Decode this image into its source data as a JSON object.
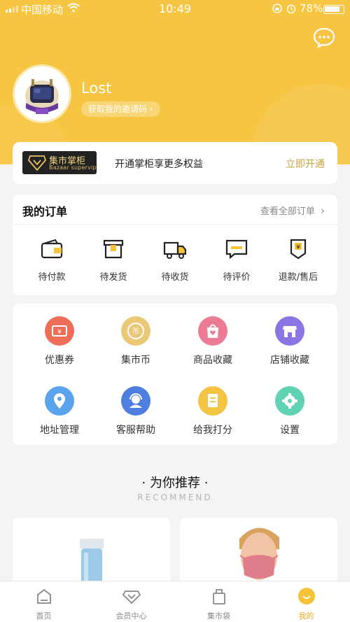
{
  "status_bar": {
    "carrier": "中国移动",
    "time": "10:49",
    "battery": "78%"
  },
  "header": {
    "username": "Lost",
    "invite_label": "获取我的邀请码",
    "invite_chevron": "›",
    "message_icon": "chat-bubble-icon"
  },
  "vip": {
    "badge_title": "集市掌柜",
    "badge_sub": "Bazaar supervip",
    "text": "开通掌柜享更多权益",
    "action": "立即开通"
  },
  "orders": {
    "title": "我的订单",
    "view_all": "查看全部订单",
    "chevron": "›",
    "items": [
      {
        "label": "待付款",
        "icon": "wallet-icon"
      },
      {
        "label": "待发货",
        "icon": "box-icon"
      },
      {
        "label": "待收货",
        "icon": "truck-icon"
      },
      {
        "label": "待评价",
        "icon": "comment-icon"
      },
      {
        "label": "退款/售后",
        "icon": "refund-icon"
      }
    ]
  },
  "tools": {
    "items": [
      {
        "label": "优惠券",
        "icon": "coupon-icon",
        "color": "#ee6e5a",
        "glyph": "¥"
      },
      {
        "label": "集市币",
        "icon": "coin-icon",
        "color": "#e9c876",
        "glyph": "币"
      },
      {
        "label": "商品收藏",
        "icon": "favorite-goods-icon",
        "color": "#ec7c95",
        "glyph": ""
      },
      {
        "label": "店铺收藏",
        "icon": "favorite-shop-icon",
        "color": "#8b74e4",
        "glyph": ""
      },
      {
        "label": "地址管理",
        "icon": "location-icon",
        "color": "#5ba3ec",
        "glyph": ""
      },
      {
        "label": "客服帮助",
        "icon": "customer-service-icon",
        "color": "#4e7fe0",
        "glyph": ""
      },
      {
        "label": "给我打分",
        "icon": "rating-icon",
        "color": "#f3c344",
        "glyph": ""
      },
      {
        "label": "设置",
        "icon": "gear-icon",
        "color": "#5fd2b4",
        "glyph": ""
      }
    ]
  },
  "recommend": {
    "title": "· 为你推荐 ·",
    "subtitle": "RECOMMEND"
  },
  "tabbar": {
    "items": [
      {
        "label": "首页",
        "icon": "home-icon",
        "active": false
      },
      {
        "label": "会员中心",
        "icon": "diamond-icon",
        "active": false
      },
      {
        "label": "集市袋",
        "icon": "bag-icon",
        "active": false
      },
      {
        "label": "我的",
        "icon": "profile-icon",
        "active": true
      }
    ]
  },
  "colors": {
    "brand_yellow": "#f6c542",
    "accent_gold": "#c9a341",
    "tab_active": "#e6ab1e"
  }
}
